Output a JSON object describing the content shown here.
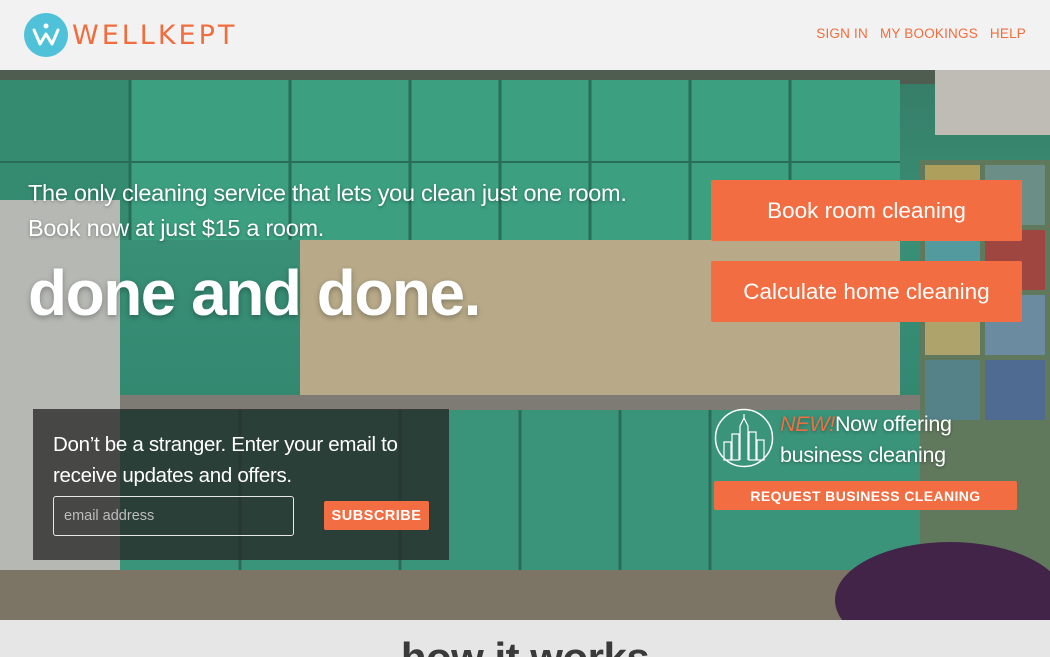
{
  "brand": {
    "name": "WELLKEPT",
    "icon": "wellkept-logo-icon",
    "color": "#f26d3d"
  },
  "nav": {
    "sign_in": "SIGN IN",
    "my_bookings": "MY BOOKINGS",
    "help": "HELP"
  },
  "hero": {
    "tagline_1": "The only cleaning service that lets you clean just one room.",
    "tagline_2": "Book now at just $15 a room.",
    "headline": "done and done.",
    "book_button": "Book room cleaning",
    "calculate_button": "Calculate home cleaning",
    "accent_color": "#f26d42"
  },
  "newsletter": {
    "message": "Don’t be a stranger. Enter your email to receive updates and offers.",
    "email_placeholder": "email address",
    "subscribe_button": "SUBSCRIBE"
  },
  "business": {
    "icon": "city-skyline-icon",
    "new_label": "NEW!",
    "text_1": "Now offering",
    "text_2": "business cleaning",
    "request_button": "REQUEST BUSINESS CLEANING"
  },
  "how_it_works": {
    "title": "how it works"
  }
}
